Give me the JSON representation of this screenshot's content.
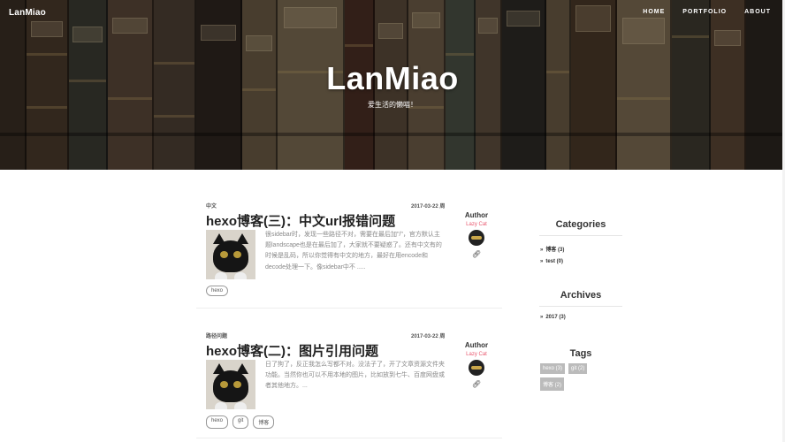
{
  "nav": {
    "brand": "LanMiao",
    "links": [
      "HOME",
      "PORTFOLIO",
      "ABOUT"
    ]
  },
  "hero": {
    "title": "LanMiao",
    "subtitle": "爱生活的懒喵！",
    "background": "bookshelf-photo"
  },
  "posts": [
    {
      "category": "中文",
      "date": "2017-03-22 周",
      "title": "hexo博客(三)：中文url报错问题",
      "excerpt": "很sidebar时，发现一些路径不对，需要在最后加\"/\"，官方默认主题landscape也是在最后加了，大家就不要疑惑了。还有中文有的时候是乱码，所以你觉得有中文的地方，最好在用encode和decode处理一下。像sidebar中不 .....",
      "tags": [
        "hexo"
      ],
      "author_label": "Author",
      "author_name": "Lazy Cat",
      "thumb": "black-cat-photo"
    },
    {
      "category": "路径问题",
      "date": "2017-03-22 周",
      "title": "hexo博客(二)：图片引用问题",
      "excerpt": "日了狗了，反正我怎么写都不对。没法子了，开了文章资源文件夹功能。当然你也可以不用本地的图片，比如放到七牛、百度网盘或者其他地方。...",
      "tags": [
        "hexo",
        "git",
        "博客"
      ],
      "author_label": "Author",
      "author_name": "Lazy Cat",
      "thumb": "black-cat-photo"
    }
  ],
  "sidebar": {
    "categories_title": "Categories",
    "categories": [
      "博客 (3)",
      "test (0)"
    ],
    "archives_title": "Archives",
    "archives": [
      "2017 (3)"
    ],
    "tags_title": "Tags",
    "tags": [
      "hexo (3)",
      "git (2)",
      "博客 (2)"
    ]
  },
  "colors": {
    "accent_author": "#e8566d",
    "tag_bg": "#bbbbbb"
  },
  "icons": {
    "chevron": "»",
    "link": "link-icon"
  }
}
